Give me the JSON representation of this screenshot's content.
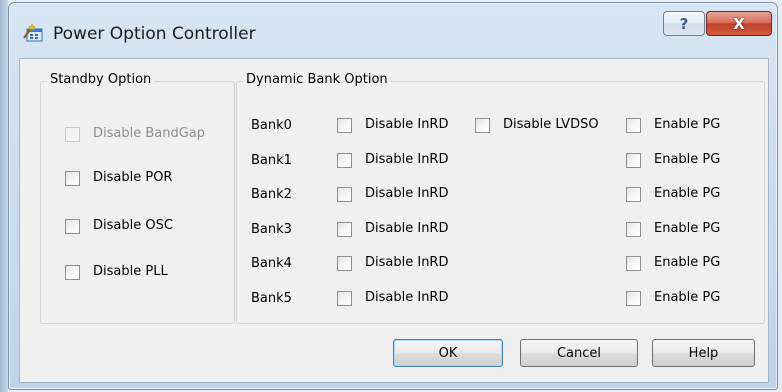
{
  "window": {
    "title": "Power Option Controller",
    "help_glyph": "?",
    "close_glyph": "X"
  },
  "standby": {
    "legend": "Standby Option",
    "items": [
      {
        "label": "Disable BandGap",
        "checked": false,
        "enabled": false
      },
      {
        "label": "Disable POR",
        "checked": false,
        "enabled": true
      },
      {
        "label": "Disable OSC",
        "checked": false,
        "enabled": true
      },
      {
        "label": "Disable PLL",
        "checked": false,
        "enabled": true
      }
    ]
  },
  "dynamic": {
    "legend": "Dynamic Bank Option",
    "banks": [
      {
        "name": "Bank0",
        "inrd": "Disable InRD",
        "lvdso": "Disable LVDSO",
        "pg": "Enable PG"
      },
      {
        "name": "Bank1",
        "inrd": "Disable InRD",
        "pg": "Enable PG"
      },
      {
        "name": "Bank2",
        "inrd": "Disable InRD",
        "pg": "Enable PG"
      },
      {
        "name": "Bank3",
        "inrd": "Disable InRD",
        "pg": "Enable PG"
      },
      {
        "name": "Bank4",
        "inrd": "Disable InRD",
        "pg": "Enable PG"
      },
      {
        "name": "Bank5",
        "inrd": "Disable InRD",
        "pg": "Enable PG"
      }
    ]
  },
  "buttons": {
    "ok": "OK",
    "cancel": "Cancel",
    "help": "Help"
  },
  "icons": {
    "app": "wand-window-icon",
    "help": "question-mark-icon",
    "close": "close-x-icon"
  },
  "colors": {
    "close_red": "#c2402a",
    "dialog_bg": "#f0f0f0",
    "frame_blue": "#c9dbee"
  }
}
